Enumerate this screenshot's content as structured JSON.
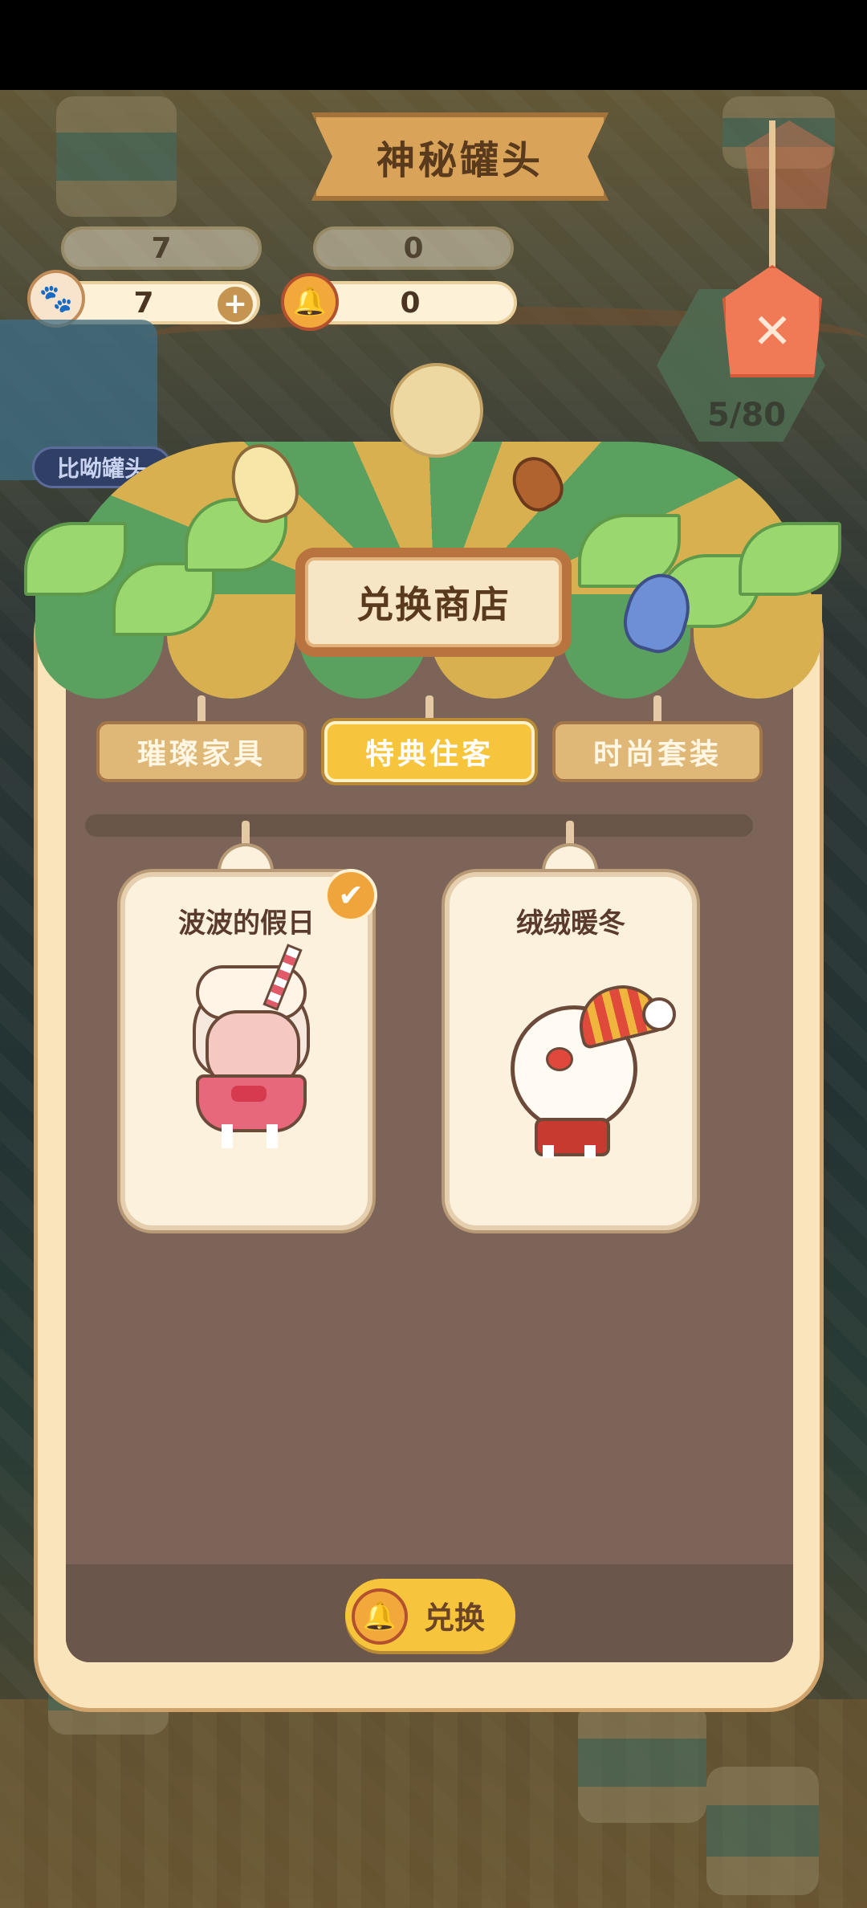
{
  "header": {
    "title": "神秘罐头",
    "side_label": "比呦罐头",
    "progress": "5/80",
    "close_glyph": "✕"
  },
  "currencies": [
    {
      "name": "paw",
      "value": "7",
      "plus": "+"
    },
    {
      "name": "bell",
      "value": "0"
    }
  ],
  "shop": {
    "title": "兑换商店",
    "tabs": [
      {
        "label": "璀璨家具",
        "active": false
      },
      {
        "label": "特典住客",
        "active": true
      },
      {
        "label": "时尚套装",
        "active": false
      }
    ],
    "items": [
      {
        "title": "波波的假日",
        "selected": true,
        "check_glyph": "✔"
      },
      {
        "title": "绒绒暖冬",
        "selected": false
      }
    ],
    "redeem_label": "兑换"
  },
  "icons": {
    "paw": "🐾",
    "bell": "🔔"
  },
  "colors": {
    "accent": "#f6c53c",
    "panel": "#f9e4bb",
    "panel_inner": "#7c6558",
    "close_tag": "#ef7a55"
  }
}
